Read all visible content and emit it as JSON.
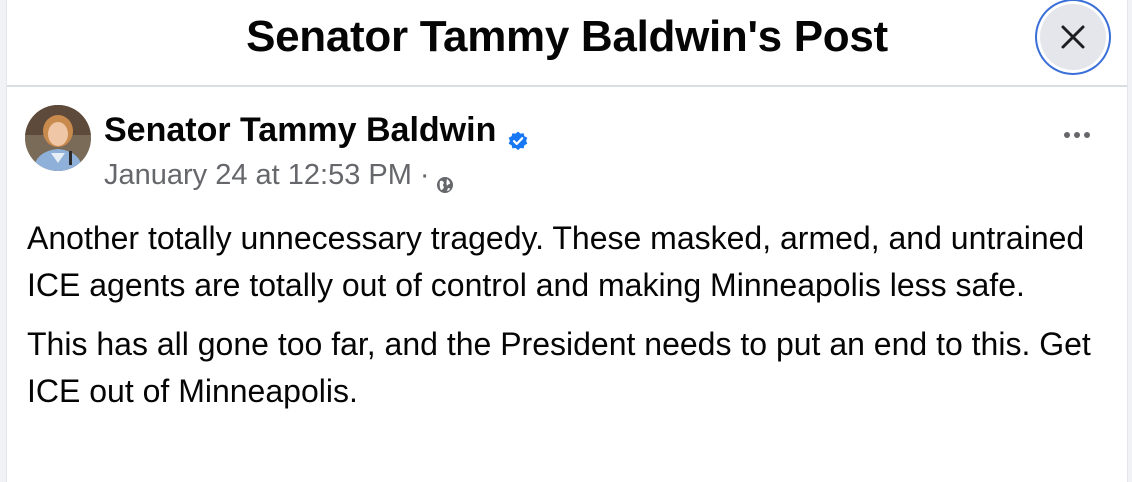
{
  "dialog": {
    "title": "Senator Tammy Baldwin's Post",
    "close_icon": "close-icon"
  },
  "post": {
    "author": "Senator Tammy Baldwin",
    "verified_icon": "verified-badge-icon",
    "timestamp": "January 24 at 12:53 PM",
    "separator": "·",
    "audience_icon": "globe-icon",
    "more_icon": "more-options-icon",
    "paragraphs": [
      "Another totally unnecessary tragedy. These masked, armed, and untrained ICE agents are totally out of control and making Minneapolis less safe.",
      "This has all gone too far, and the President needs to put an end to this. Get ICE out of Minneapolis."
    ]
  },
  "colors": {
    "accent": "#3b6fd8",
    "verified": "#1877f2",
    "text_primary": "#050505",
    "text_secondary": "#65676b"
  }
}
